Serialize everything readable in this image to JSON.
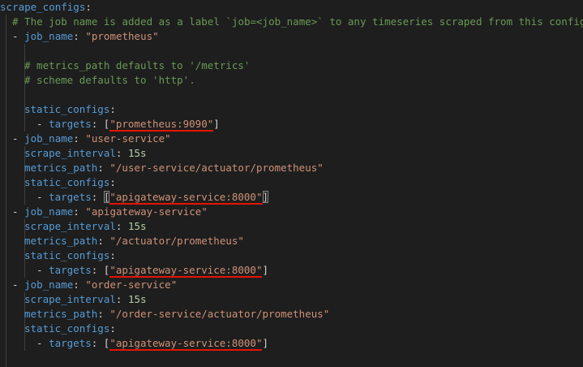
{
  "editor": {
    "root_key": "scrape_configs",
    "job_label_comment": "# The job name is added as a label `job=<job_name>` to any timeseries scraped from this config",
    "metrics_path_comment": "# metrics_path defaults to '/metrics'",
    "scheme_comment": "# scheme defaults to 'http'.",
    "keys": {
      "job_name": "job_name",
      "static_configs": "static_configs",
      "targets": "targets",
      "scrape_interval": "scrape_interval",
      "metrics_path": "metrics_path"
    },
    "jobs": [
      {
        "job_name": "\"prometheus\"",
        "target": "\"prometheus:9090\""
      },
      {
        "job_name": "\"user-service\"",
        "scrape_interval": "15s",
        "metrics_path": "\"/user-service/actuator/prometheus\"",
        "target": "\"apigateway-service:8000\""
      },
      {
        "job_name": "\"apigateway-service\"",
        "scrape_interval": "15s",
        "metrics_path": "\"/actuator/prometheus\"",
        "target": "\"apigateway-service:8000\""
      },
      {
        "job_name": "\"order-service\"",
        "scrape_interval": "15s",
        "metrics_path": "\"/order-service/actuator/prometheus\"",
        "target": "\"apigateway-service:8000\""
      }
    ]
  },
  "colors": {
    "background": "#1e1e1e",
    "key": "#569cd6",
    "string": "#ce9178",
    "number": "#b5cea8",
    "comment": "#6a9955",
    "underline": "#e51400"
  }
}
